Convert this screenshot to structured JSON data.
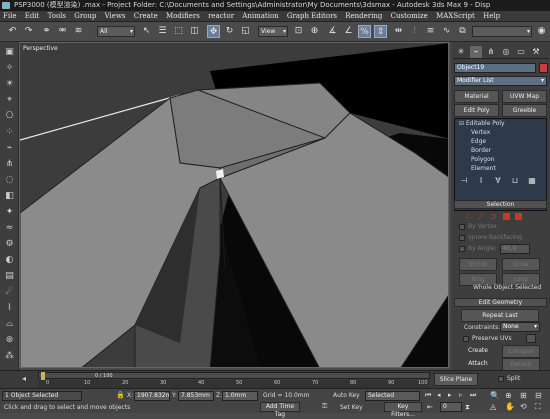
{
  "window": {
    "title": "PSP3000 (模型渲染) .max - Project Folder: C:\\Documents and Settings\\Administrator\\My Documents\\3dsmax - Autodesk 3ds Max 9 - Disp"
  },
  "menu": {
    "items": [
      "File",
      "Edit",
      "Tools",
      "Group",
      "Views",
      "Create",
      "Modifiers",
      "reactor",
      "Animation",
      "Graph Editors",
      "Rendering",
      "Customize",
      "MAXScript",
      "Help"
    ]
  },
  "toolbar": {
    "selection_filter": "All",
    "reference_coord": "View"
  },
  "viewport": {
    "label": "Perspective",
    "background": "#3c3c3c"
  },
  "command_panel": {
    "object_name": "Object19",
    "object_color": "#c83c3c",
    "modifier_list": "Modifier List",
    "buttons": {
      "material": "Material",
      "uvw_map": "UVW Map",
      "edit_poly": "Edit Poly",
      "greeble": "Greeble"
    },
    "stack": {
      "root": "Editable Poly",
      "items": [
        "Vertex",
        "Edge",
        "Border",
        "Polygon",
        "Element"
      ]
    },
    "selection": {
      "header": "Selection",
      "by_vertex": "By Vertex",
      "ignore_backfacing": "Ignore Backfacing",
      "by_angle": "By Angle:",
      "angle_value": "45.0",
      "shrink": "Shrink",
      "grow": "Grow",
      "ring": "Ring",
      "loop": "Loop",
      "status": "Whole Object Selected"
    },
    "edit_geometry": {
      "header": "Edit Geometry",
      "repeat_last": "Repeat Last",
      "constraints_label": "Constraints:",
      "constraints_value": "None",
      "preserve_uvs": "Preserve UVs",
      "create": "Create",
      "collapse": "Collapse",
      "attach": "Attach",
      "detach": "Detach",
      "slice_plane": "Slice Plane",
      "split": "Split"
    }
  },
  "timeline": {
    "frame_label": "0 / 100",
    "ticks": [
      "0",
      "10",
      "20",
      "30",
      "40",
      "50",
      "60",
      "70",
      "80",
      "90",
      "100"
    ]
  },
  "status": {
    "selected_count": "1 Object Selected",
    "prompt": "Click and drag to select and move objects",
    "x": "1907.832m",
    "y": "7.853mm",
    "z": "1.0mm",
    "grid": "Grid = 10.0mm",
    "auto_key": "Auto Key",
    "set_key": "Set Key",
    "key_mode": "Selected",
    "key_filters": "Key Filters...",
    "add_time_tag": "Add Time Tag",
    "frame": "0"
  }
}
